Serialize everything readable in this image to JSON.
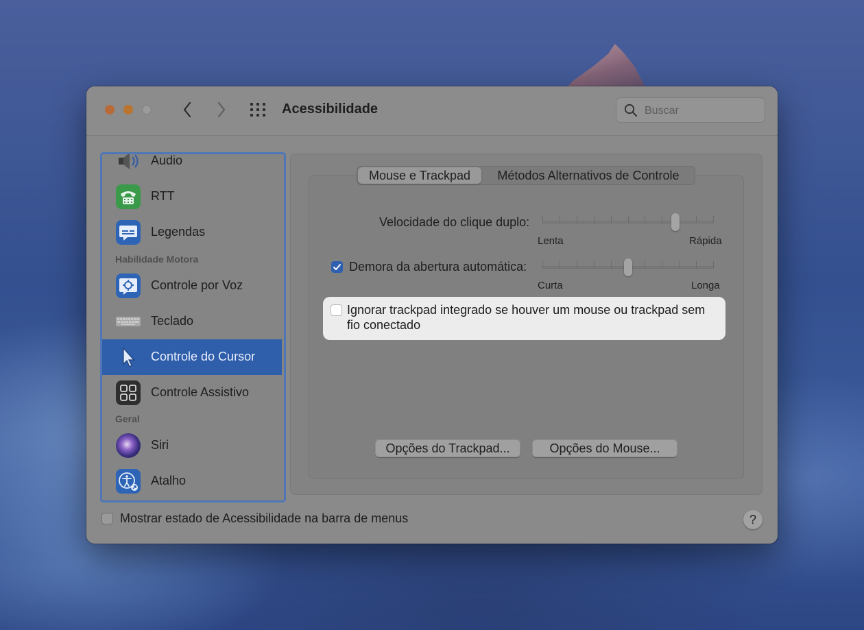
{
  "window": {
    "title": "Acessibilidade",
    "search_placeholder": "Buscar"
  },
  "sidebar": {
    "items": [
      {
        "label": "Audio",
        "icon": "speaker-icon"
      },
      {
        "label": "RTT",
        "icon": "rtt-phone-icon"
      },
      {
        "label": "Legendas",
        "icon": "captions-icon"
      },
      {
        "label": "Controle por Voz",
        "icon": "voice-control-icon"
      },
      {
        "label": "Teclado",
        "icon": "keyboard-icon"
      },
      {
        "label": "Controle do Cursor",
        "icon": "pointer-icon",
        "selected": true
      },
      {
        "label": "Controle Assistivo",
        "icon": "switch-grid-icon"
      },
      {
        "label": "Siri",
        "icon": "siri-icon"
      },
      {
        "label": "Atalho",
        "icon": "accessibility-shortcut-icon"
      }
    ],
    "sections": {
      "motor": "Habilidade Motora",
      "general": "Geral"
    }
  },
  "tabs": [
    {
      "label": "Mouse e Trackpad",
      "active": true
    },
    {
      "label": "Métodos Alternativos de Controle",
      "active": false
    }
  ],
  "settings": {
    "double_click": {
      "label": "Velocidade do clique duplo:",
      "min_label": "Lenta",
      "max_label": "Rápida",
      "value_fraction": 0.79
    },
    "spring_loading": {
      "label": "Demora da abertura automática:",
      "checked": true,
      "min_label": "Curta",
      "max_label": "Longa",
      "value_fraction": 0.5
    },
    "ignore_trackpad": {
      "label": "Ignorar trackpad integrado se houver um mouse ou trackpad sem fio conectado",
      "checked": false
    }
  },
  "buttons": {
    "trackpad_options": "Opções do Trackpad...",
    "mouse_options": "Opções do Mouse..."
  },
  "footer": {
    "show_status_label": "Mostrar estado de Acessibilidade na barra de menus",
    "show_status_checked": false,
    "help": "?"
  },
  "colors": {
    "accent": "#2f5eaa",
    "sidebar_border": "#4f77b7"
  }
}
